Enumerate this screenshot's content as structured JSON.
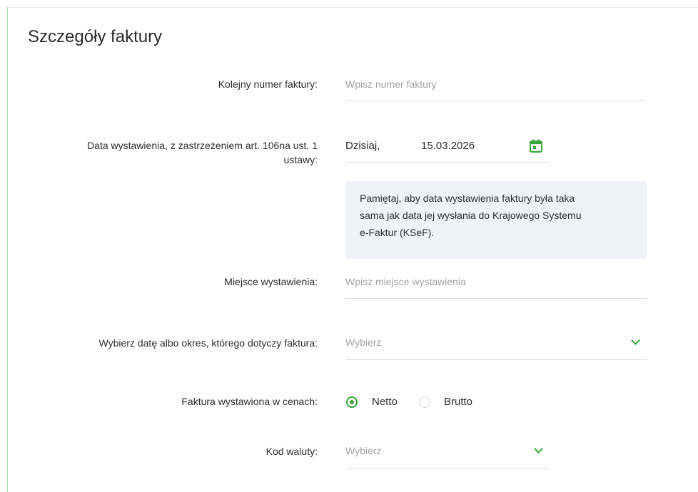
{
  "title": "Szczegóły faktury",
  "fields": {
    "invoice_number": {
      "label": "Kolejny numer faktury:",
      "placeholder": "Wpisz numer faktury"
    },
    "issue_date": {
      "label_line1": "Data wystawienia, z zastrzeżeniem art. 106na ust. 1",
      "label_line2": "ustawy:",
      "prefix": "Dzisiaj,",
      "value": "15.03.2026"
    },
    "info_box": {
      "line1": "Pamiętaj, aby data wystawienia faktury była taka",
      "line2": "sama jak data jej wysłania do Krajowego Systemu",
      "line3": "e-Faktur (KSeF)."
    },
    "place": {
      "label": "Miejsce wystawienia:",
      "placeholder": "Wpisz miejsce wystawienia"
    },
    "period": {
      "label": "Wybierz datę albo okres, którego dotyczy faktura:",
      "placeholder": "Wybierz"
    },
    "price_type": {
      "label": "Faktura wystawiona w cenach:",
      "options": [
        "Netto",
        "Brutto"
      ],
      "selected": "Netto"
    },
    "currency": {
      "label": "Kod waluty:",
      "placeholder": "Wybierz"
    }
  },
  "icons": {
    "calendar": "calendar-icon",
    "dropdown": "chevron-down-icon"
  },
  "colors": {
    "accent": "#3aa53a",
    "info_bg": "#eff3f8",
    "placeholder": "#a3a3a3"
  }
}
